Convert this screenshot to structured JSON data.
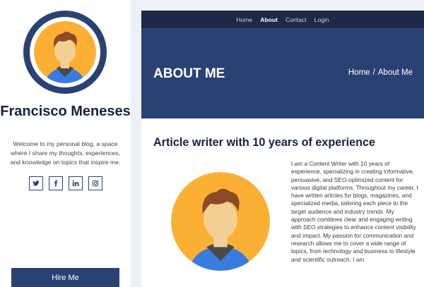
{
  "sidebar": {
    "name": "Francisco Meneses",
    "bio": "Welcome to my personal blog, a space where I share my thoughts, experiences, and knowledge on topics that inspire me.",
    "socials": [
      {
        "icon": "twitter-icon"
      },
      {
        "icon": "facebook-icon"
      },
      {
        "icon": "linkedin-icon"
      },
      {
        "icon": "instagram-icon"
      }
    ],
    "hire_label": "Hire Me"
  },
  "nav": {
    "items": [
      "Home",
      "About",
      "Contact",
      "Login"
    ],
    "active": "About"
  },
  "hero": {
    "title": "ABOUT ME",
    "breadcrumb": [
      "Home",
      "/",
      "About Me"
    ]
  },
  "article": {
    "headline": "Article writer with 10 years of experience",
    "body": "I am a Content Writer with 10 years of experience, specializing in creating informative, persuasive, and SEO-optimized content for various digital platforms. Throughout my career, I have written articles for blogs, magazines, and specialized media, tailoring each piece to the target audience and industry trends. My approach combines clear and engaging writing with SEO strategies to enhance content visibility and impact. My passion for communication and research allows me to cover a wide range of topics, from technology and business to lifestyle and scientific outreach. I am"
  },
  "colors": {
    "primary": "#2a4273",
    "nav_bg": "#1d2946",
    "avatar_bg": "#fbb034",
    "shirt": "#3a7be0",
    "page_bg": "#eef0f7"
  }
}
